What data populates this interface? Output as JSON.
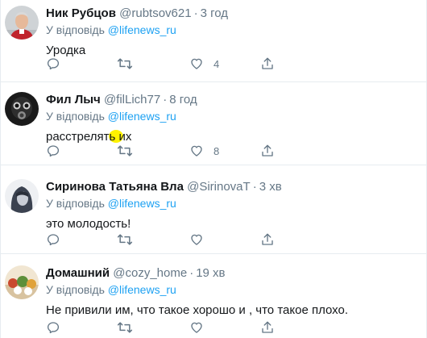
{
  "tweets": [
    {
      "name": "Ник Рубцов",
      "handle": "@rubtsov621",
      "time": "3 год",
      "reply_prefix": "У відповідь",
      "reply_to": "@lifenews_ru",
      "text": "Уродка",
      "replies": "",
      "retweets": "",
      "likes": "4",
      "avatar_icon": "man-in-red-jacket-avatar"
    },
    {
      "name": "Фил Лыч",
      "handle": "@filLich77",
      "time": "8 год",
      "reply_prefix": "У відповідь",
      "reply_to": "@lifenews_ru",
      "text": "расстрелять их",
      "replies": "",
      "retweets": "",
      "likes": "8",
      "avatar_icon": "gas-mask-avatar"
    },
    {
      "name": "Сиринова Татьяна Вла",
      "handle": "@SirinovaT",
      "time": "3 хв",
      "reply_prefix": "У відповідь",
      "reply_to": "@lifenews_ru",
      "text": "это молодость!",
      "replies": "",
      "retweets": "",
      "likes": "",
      "avatar_icon": "hooded-girl-avatar"
    },
    {
      "name": "Домашний",
      "handle": "@cozy_home",
      "time": "19 хв",
      "reply_prefix": "У відповідь",
      "reply_to": "@lifenews_ru",
      "text": "Не привили им, что такое хорошо и , что такое плохо.",
      "replies": "",
      "retweets": "",
      "likes": "",
      "avatar_icon": "food-table-avatar"
    }
  ],
  "colors": {
    "accent": "#1da1f2",
    "muted": "#657786",
    "text": "#14171a",
    "divider": "#e6ecf0",
    "highlight": "#fff200"
  }
}
